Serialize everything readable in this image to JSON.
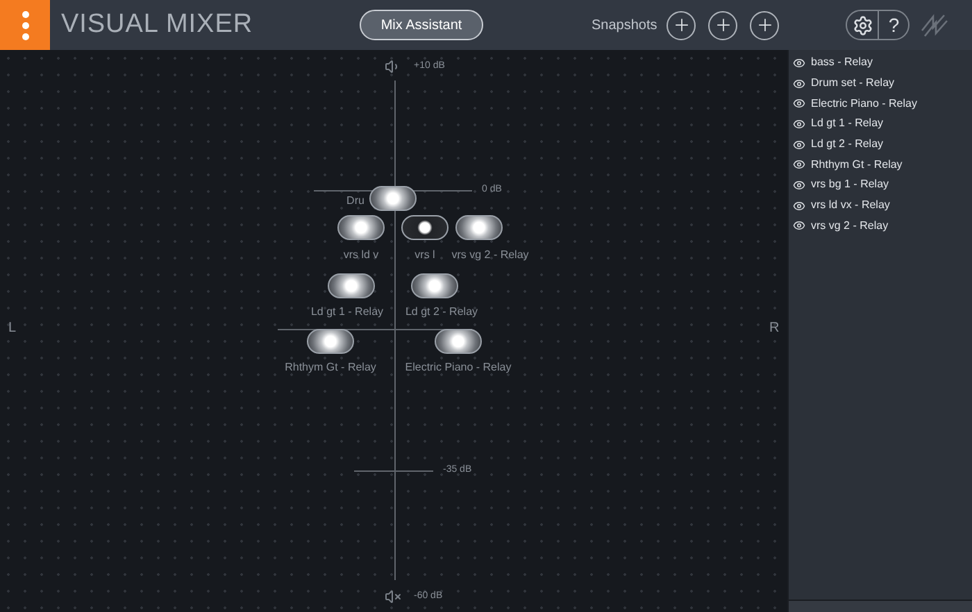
{
  "header": {
    "title": "VISUAL MIXER",
    "mix_button": "Mix Assistant",
    "snapshots_label": "Snapshots",
    "help_label": "?",
    "snapshot_buttons": [
      {
        "kind": "add"
      },
      {
        "kind": "add"
      },
      {
        "kind": "add"
      }
    ]
  },
  "canvas": {
    "left_label": "L",
    "right_label": "R",
    "scale": [
      {
        "kind": "top",
        "label": "+10 dB"
      },
      {
        "kind": "zero",
        "label": "0 dB"
      },
      {
        "kind": "mid",
        "label": "-35 dB"
      },
      {
        "kind": "bottom",
        "label": "-60 dB"
      }
    ],
    "pucks": [
      {
        "label": "Dru"
      },
      {
        "label": "vrs ld v"
      },
      {
        "label": "vrs l"
      },
      {
        "label": "vrs vg 2 - Relay"
      },
      {
        "label": "Ld gt 1 - Relay"
      },
      {
        "label": "Ld gt 2 - Relay"
      },
      {
        "label": "Rhthym Gt - Relay"
      },
      {
        "label": "Electric Piano - Relay"
      }
    ]
  },
  "tracks": [
    {
      "name": "bass - Relay",
      "visible": true
    },
    {
      "name": "Drum set - Relay",
      "visible": true
    },
    {
      "name": "Electric Piano - Relay",
      "visible": true
    },
    {
      "name": "Ld gt 1 - Relay",
      "visible": true
    },
    {
      "name": "Ld gt 2 - Relay",
      "visible": true
    },
    {
      "name": "Rhthym Gt - Relay",
      "visible": true
    },
    {
      "name": "vrs bg 1 - Relay",
      "visible": true
    },
    {
      "name": "vrs ld vx - Relay",
      "visible": true
    },
    {
      "name": "vrs vg 2 - Relay",
      "visible": true
    }
  ]
}
